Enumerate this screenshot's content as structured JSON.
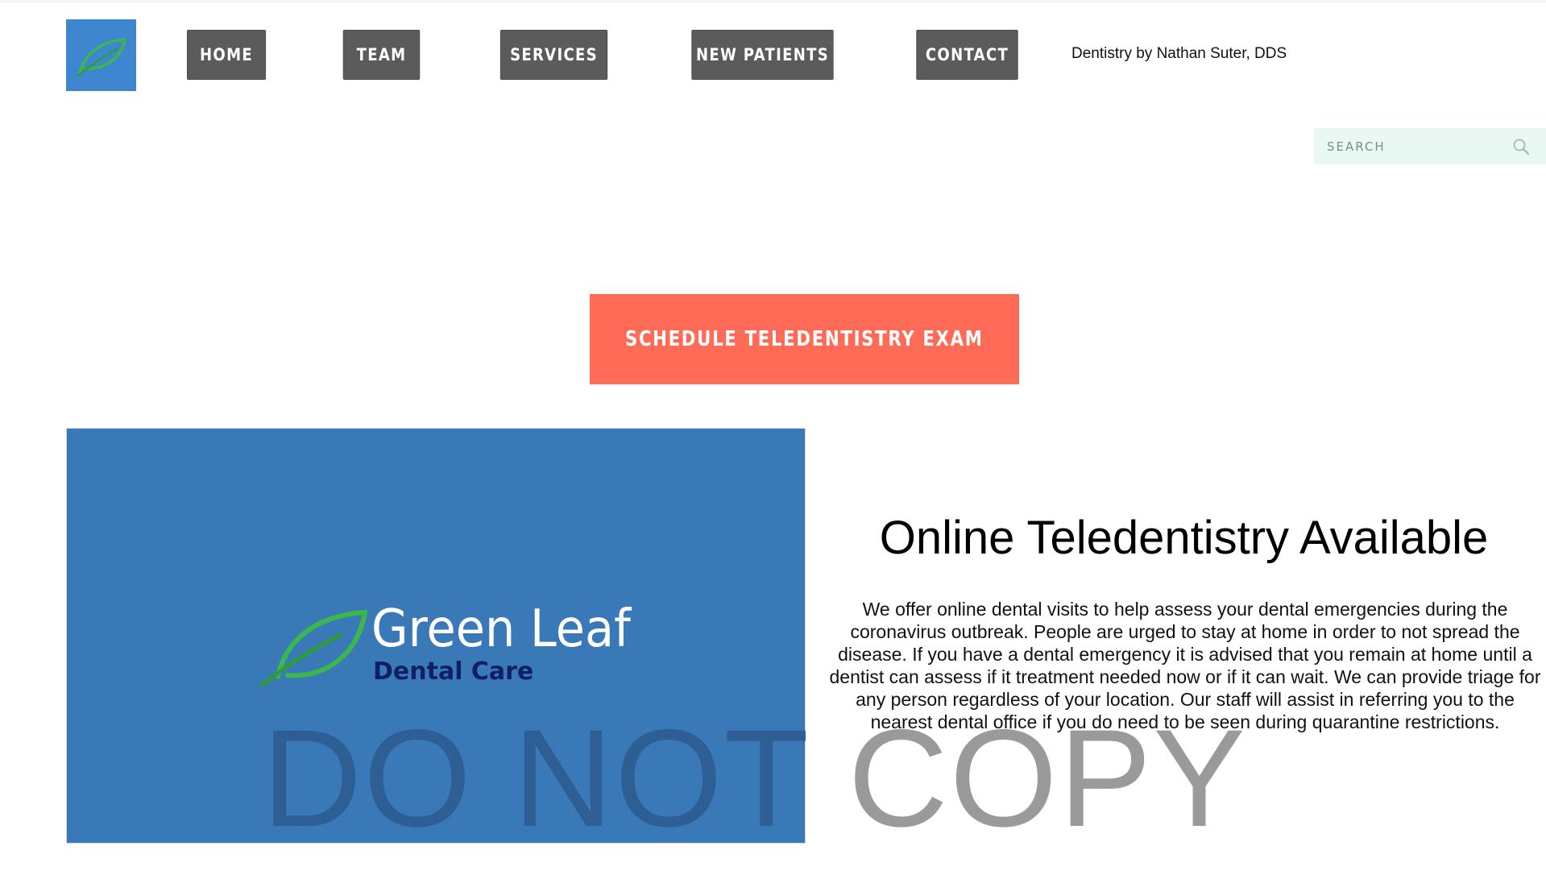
{
  "header": {
    "logo_icon": "leaf-icon",
    "nav": [
      {
        "label": "HOME"
      },
      {
        "label": "TEAM"
      },
      {
        "label": "SERVICES"
      },
      {
        "label": "NEW PATIENTS"
      },
      {
        "label": "CONTACT"
      }
    ],
    "tagline": "Dentistry by Nathan Suter, DDS"
  },
  "search": {
    "placeholder": "SEARCH",
    "icon": "search-icon"
  },
  "cta": {
    "label": "SCHEDULE TELEDENTISTRY EXAM",
    "color": "#ff6b57"
  },
  "hero_image": {
    "brand_name": "Green Leaf",
    "brand_sub": "Dental Care",
    "icon": "leaf-icon",
    "background": "#3a79b8"
  },
  "content": {
    "title": "Online Teledentistry Available",
    "body": "We offer online dental visits to help assess your dental emergencies during the coronavirus outbreak. People are urged to stay at home in order to not spread the disease. If you have a dental emergency it is advised that you remain at home until a dentist can assess if it treatment needed now or if it can wait. We can provide triage for any person regardless of your location. Our staff will assist in referring you to the nearest dental office if you do need to be seen during quarantine restrictions."
  },
  "watermark": {
    "part_a": "DO NOT ",
    "part_b": "COPY"
  },
  "colors": {
    "nav_bg": "#5b5b5b",
    "logo_bg": "#3f86d1",
    "leaf_green": "#3cb84a",
    "search_bg": "#eaf8f3"
  }
}
